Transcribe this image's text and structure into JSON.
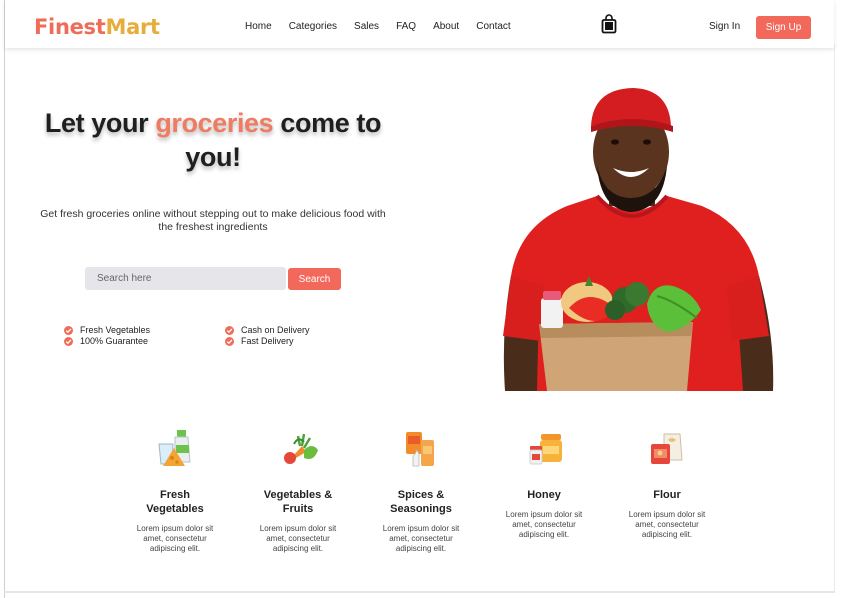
{
  "brand": {
    "name_part1": "Finest",
    "name_part2": "Mart",
    "color1": "#ef6c58",
    "color2": "#e7ad3c"
  },
  "nav": {
    "items": [
      "Home",
      "Categories",
      "Sales",
      "FAQ",
      "About",
      "Contact"
    ]
  },
  "header": {
    "cart_icon": "shopping-bag-icon",
    "signin_label": "Sign In",
    "signup_label": "Sign Up"
  },
  "hero": {
    "title_part1": "Let your ",
    "title_highlight": "groceries",
    "title_part2": " come to you!",
    "subtitle": "Get fresh groceries online without stepping out to make delicious food with the freshest ingredients",
    "search_placeholder": "Search here",
    "search_button": "Search",
    "features": [
      "Fresh Vegetables",
      "100% Guarantee",
      "Cash on Delivery",
      "Fast Delivery"
    ],
    "accent": "#f2695c"
  },
  "categories": [
    {
      "title": "Fresh Vegetables",
      "desc": "Lorem ipsum dolor sit amet, consectetur adipiscing elit.",
      "icon": "dairy-cheese-icon"
    },
    {
      "title": "Vegetables & Fruits",
      "desc": "Lorem ipsum dolor sit amet, consectetur adipiscing elit.",
      "icon": "vegetables-icon"
    },
    {
      "title": "Spices & Seasonings",
      "desc": "Lorem ipsum dolor sit amet, consectetur adipiscing elit.",
      "icon": "spices-icon"
    },
    {
      "title": "Honey",
      "desc": "Lorem ipsum dolor sit amet, consectetur adipiscing elit.",
      "icon": "honey-jar-icon"
    },
    {
      "title": "Flour",
      "desc": "Lorem ipsum dolor sit amet, consectetur adipiscing elit.",
      "icon": "flour-bag-icon"
    }
  ]
}
